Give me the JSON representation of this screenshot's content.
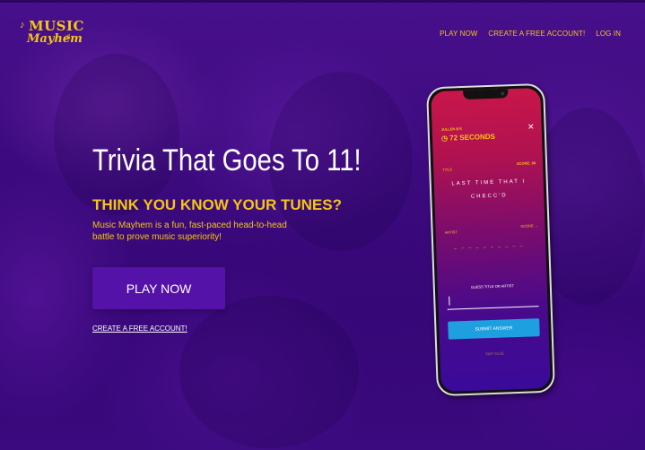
{
  "logo": {
    "line1": "MUSIC",
    "line2": "Mayhem"
  },
  "nav": {
    "items": [
      "PLAY NOW",
      "CREATE A FREE ACCOUNT!",
      "LOG IN"
    ]
  },
  "hero": {
    "headline": "Trivia That Goes To 11!",
    "subhead": "THINK YOU KNOW YOUR TUNES?",
    "description": "Music Mayhem is a fun, fast-paced head-to-head battle to prove music superiority!",
    "play_button": "PLAY NOW",
    "create_link": "CREATE A FREE ACCOUNT!"
  },
  "phone": {
    "timer_label": "JULLEN B'S",
    "timer": "72 SECONDS",
    "close": "✕",
    "title_label": "TITLE",
    "score1": "SCORE: 86",
    "clue": "LAST TIME THAT I CHECC'D",
    "artist_label": "ARTIST",
    "score2": "SCORE: --",
    "dashes": "_ _ _ _   _ _ _ _ _ _",
    "guess_label": "GUESS TITLE OR ARTIST",
    "submit": "SUBMIT ANSWER",
    "skip": "SKIP CLUE"
  },
  "colors": {
    "accent": "#f4c612",
    "button": "#5512a8",
    "submit": "#1ea0e0",
    "background": "#3a0a7a"
  }
}
